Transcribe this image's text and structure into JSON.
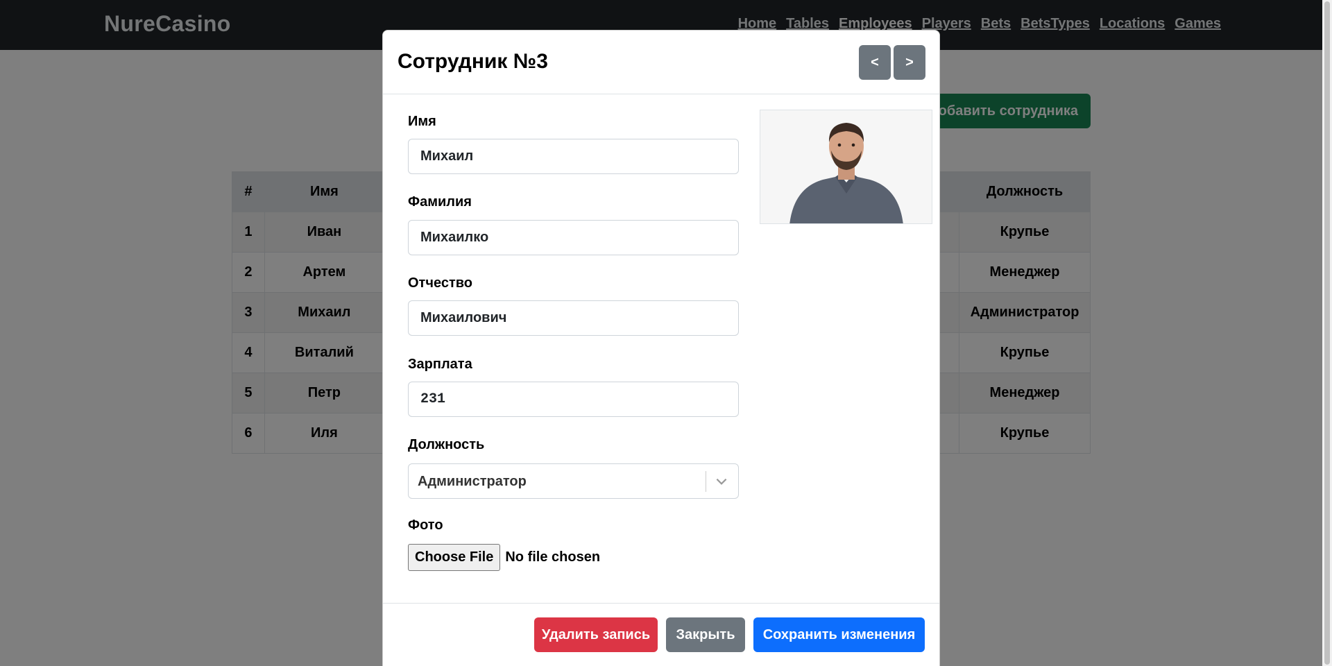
{
  "navbar": {
    "brand": "NureCasino",
    "links": [
      "Home",
      "Tables",
      "Employees",
      "Players",
      "Bets",
      "BetsTypes",
      "Locations",
      "Games"
    ]
  },
  "page": {
    "add_button": "Добавить сотрудника",
    "table": {
      "headers": [
        "#",
        "Имя",
        "Должность"
      ],
      "rows": [
        {
          "num": "1",
          "name": "Иван",
          "position": "Крупье"
        },
        {
          "num": "2",
          "name": "Артем",
          "position": "Менеджер"
        },
        {
          "num": "3",
          "name": "Михаил",
          "position": "Администратор"
        },
        {
          "num": "4",
          "name": "Виталий",
          "position": "Крупье"
        },
        {
          "num": "5",
          "name": "Петр",
          "position": "Менеджер"
        },
        {
          "num": "6",
          "name": "Иля",
          "position": "Крупье"
        }
      ]
    }
  },
  "modal": {
    "title": "Сотрудник №3",
    "prev_label": "<",
    "next_label": ">",
    "fields": {
      "first_name": {
        "label": "Имя",
        "value": "Михаил"
      },
      "last_name": {
        "label": "Фамилия",
        "value": "Михаилко"
      },
      "patronymic": {
        "label": "Отчество",
        "value": "Михаилович"
      },
      "salary": {
        "label": "Зарплата",
        "value": "231"
      },
      "position": {
        "label": "Должность",
        "value": "Администратор"
      },
      "photo": {
        "label": "Фото",
        "button": "Choose File",
        "status": "No file chosen"
      }
    },
    "footer": {
      "delete": "Удалить запись",
      "close": "Закрыть",
      "save": "Сохранить изменения"
    }
  },
  "colors": {
    "navbar": "#212529",
    "success": "#198754",
    "danger": "#dc3545",
    "secondary": "#6c757d",
    "primary": "#0d6efd"
  }
}
